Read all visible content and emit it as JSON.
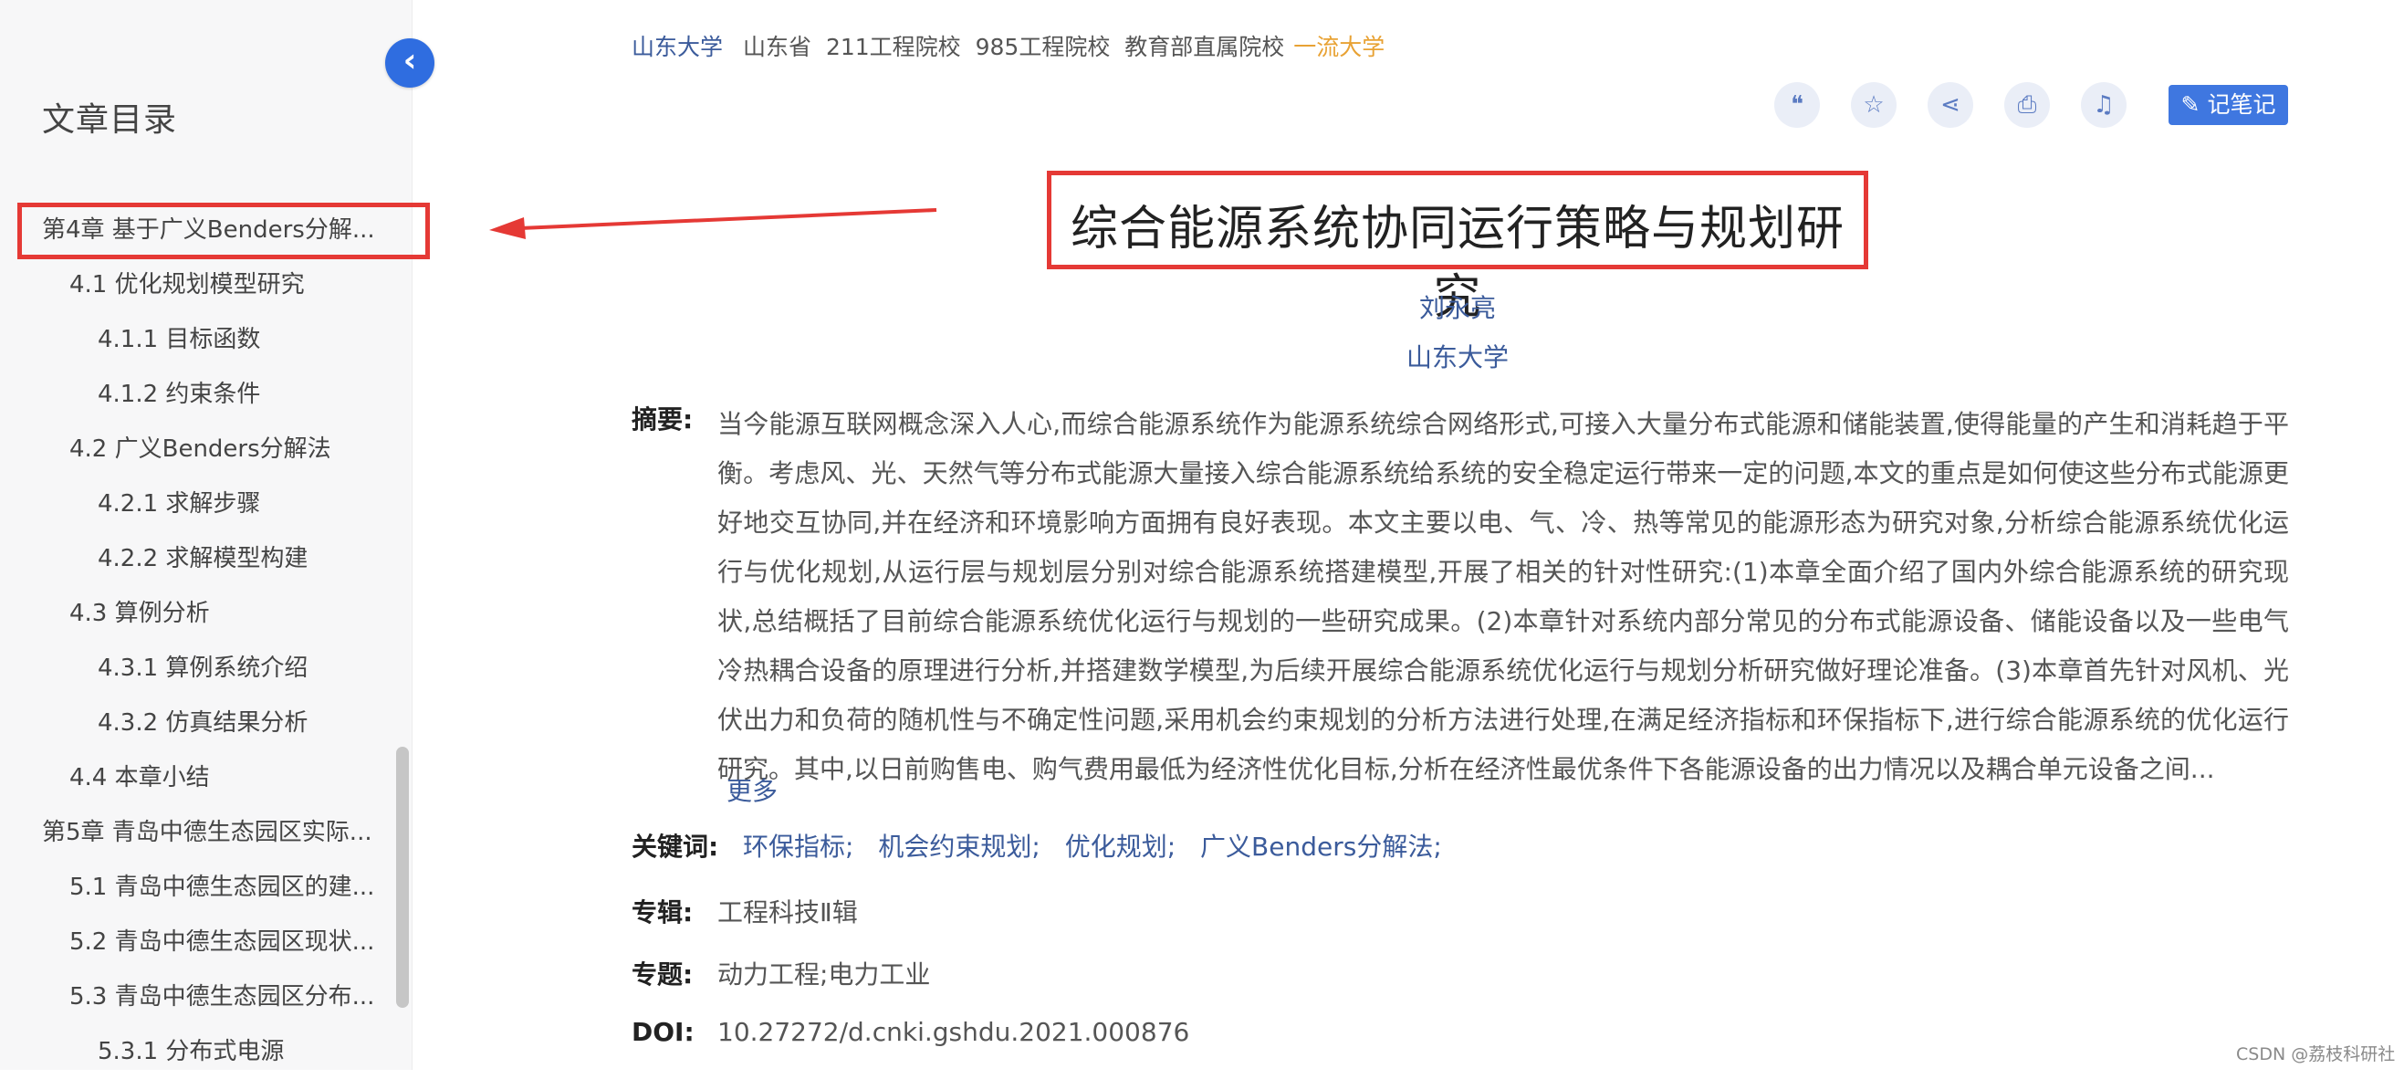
{
  "sidebar": {
    "collapse_icon": "‹",
    "title": "文章目录",
    "items": [
      {
        "label": "第4章 基于广义Benders分解...",
        "level": 1
      },
      {
        "label": "4.1 优化规划模型研究",
        "level": 2
      },
      {
        "label": "4.1.1 目标函数",
        "level": 3
      },
      {
        "label": "4.1.2 约束条件",
        "level": 3
      },
      {
        "label": "4.2 广义Benders分解法",
        "level": 2
      },
      {
        "label": "4.2.1 求解步骤",
        "level": 3
      },
      {
        "label": "4.2.2 求解模型构建",
        "level": 3
      },
      {
        "label": "4.3 算例分析",
        "level": 2
      },
      {
        "label": "4.3.1 算例系统介绍",
        "level": 3
      },
      {
        "label": "4.3.2 仿真结果分析",
        "level": 3
      },
      {
        "label": "4.4 本章小结",
        "level": 2
      },
      {
        "label": "第5章 青岛中德生态园区实际...",
        "level": 1
      },
      {
        "label": "5.1 青岛中德生态园区的建...",
        "level": 2
      },
      {
        "label": "5.2 青岛中德生态园区现状...",
        "level": 2
      },
      {
        "label": "5.3 青岛中德生态园区分布...",
        "level": 2
      },
      {
        "label": "5.3.1 分布式电源",
        "level": 3
      }
    ]
  },
  "header": {
    "school_link": "山东大学",
    "tags": [
      "山东省",
      "211工程院校",
      "985工程院校",
      "教育部直属院校"
    ],
    "highlight_tag": "一流大学"
  },
  "toolbar": {
    "icons": [
      {
        "name": "quote-icon",
        "glyph": "❝"
      },
      {
        "name": "star-icon",
        "glyph": "☆"
      },
      {
        "name": "share-icon",
        "glyph": "⋖"
      },
      {
        "name": "print-icon",
        "glyph": "⎙"
      },
      {
        "name": "bell-icon",
        "glyph": "♫"
      }
    ],
    "note_icon": "✎",
    "note_label": "记笔记"
  },
  "paper": {
    "title": "综合能源系统协同运行策略与规划研究",
    "author": "刘永亮",
    "institution": "山东大学",
    "abstract_label": "摘要:",
    "abstract": "当今能源互联网概念深入人心,而综合能源系统作为能源系统综合网络形式,可接入大量分布式能源和储能装置,使得能量的产生和消耗趋于平衡。考虑风、光、天然气等分布式能源大量接入综合能源系统给系统的安全稳定运行带来一定的问题,本文的重点是如何使这些分布式能源更好地交互协同,并在经济和环境影响方面拥有良好表现。本文主要以电、气、冷、热等常见的能源形态为研究对象,分析综合能源系统优化运行与优化规划,从运行层与规划层分别对综合能源系统搭建模型,开展了相关的针对性研究:(1)本章全面介绍了国内外综合能源系统的研究现状,总结概括了目前综合能源系统优化运行与规划的一些研究成果。(2)本章针对系统内部分常见的分布式能源设备、储能设备以及一些电气冷热耦合设备的原理进行分析,并搭建数学模型,为后续开展综合能源系统优化运行与规划分析研究做好理论准备。(3)本章首先针对风机、光伏出力和负荷的随机性与不确定性问题,采用机会约束规划的分析方法进行处理,在满足经济指标和环保指标下,进行综合能源系统的优化运行研究。其中,以日前购售电、购气费用最低为经济性优化目标,分析在经济性最优条件下各能源设备的出力情况以及耦合单元设备之间...",
    "more_label": "更多",
    "keywords_label": "关键词:",
    "keywords": [
      "环保指标;",
      "机会约束规划;",
      "优化规划;",
      "广义Benders分解法;"
    ],
    "series_label": "专辑:",
    "series": "工程科技Ⅱ辑",
    "topic_label": "专题:",
    "topic": "动力工程;电力工业",
    "doi_label": "DOI:",
    "doi": "10.27272/d.cnki.gshdu.2021.000876"
  },
  "watermark": "CSDN @荔枝科研社",
  "colors": {
    "link_blue": "#3b5b9b",
    "accent_blue": "#3f77e0",
    "highlight_red": "#e53935",
    "gold": "#e8a234"
  }
}
